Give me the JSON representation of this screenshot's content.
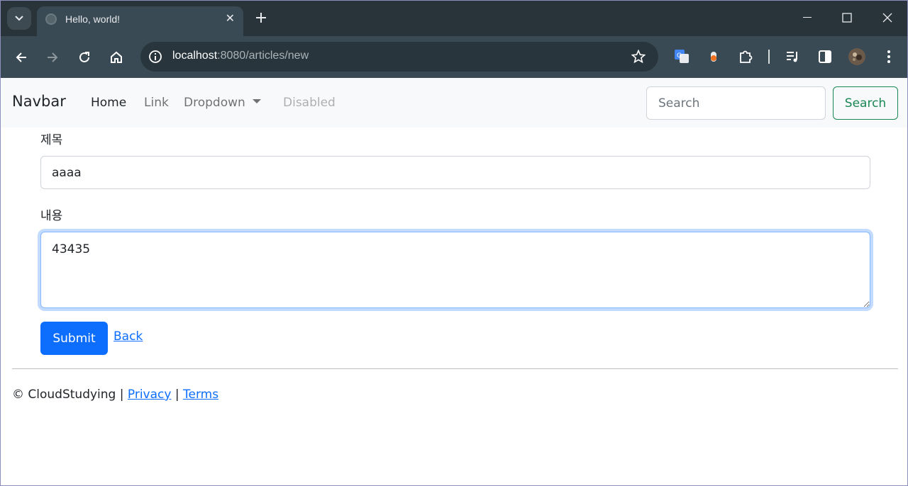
{
  "browser": {
    "tab_title": "Hello, world!",
    "tab_close": "✕",
    "url_host": "localhost",
    "url_rest": ":8080/articles/new",
    "accent": "#3a4a54"
  },
  "navbar": {
    "brand": "Navbar",
    "links": [
      "Home",
      "Link",
      "Dropdown",
      "Disabled"
    ],
    "search_placeholder": "Search",
    "search_button": "Search"
  },
  "form": {
    "title_label": "제목",
    "title_value": "aaaa",
    "content_label": "내용",
    "content_value": "43435",
    "submit_label": "Submit",
    "back_label": "Back"
  },
  "footer": {
    "copyright": "© CloudStudying",
    "sep1": "|",
    "privacy": "Privacy",
    "sep2": "|",
    "terms": "Terms"
  },
  "colors": {
    "primary": "#0d6efd",
    "success": "#198754"
  }
}
